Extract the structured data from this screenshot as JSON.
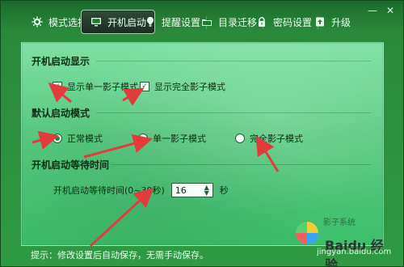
{
  "tabs": [
    {
      "label": "模式选择",
      "icon": "gear-icon",
      "active": false
    },
    {
      "label": "开机启动",
      "icon": "monitor-icon",
      "active": true
    },
    {
      "label": "提醒设置",
      "icon": "bulb-icon",
      "active": false
    },
    {
      "label": "目录迁移",
      "icon": "folder-icon",
      "active": false
    },
    {
      "label": "密码设置",
      "icon": "lock-icon",
      "active": false
    },
    {
      "label": "升级",
      "icon": "upgrade-icon",
      "active": false
    }
  ],
  "window_controls": {
    "minimize": "—",
    "close": "✕"
  },
  "sections": {
    "startup_display": {
      "title": "开机启动显示",
      "options": [
        {
          "label": "显示单一影子模式",
          "checked": true
        },
        {
          "label": "显示完全影子模式",
          "checked": true
        }
      ]
    },
    "default_mode": {
      "title": "默认启动模式",
      "options": [
        {
          "label": "正常模式",
          "selected": true
        },
        {
          "label": "单一影子模式",
          "selected": false
        },
        {
          "label": "完全影子模式",
          "selected": false
        }
      ]
    },
    "startup_wait": {
      "title": "开机启动等待时间",
      "label": "开机启动等待时间(0~30秒)",
      "value": "16",
      "unit": "秒"
    }
  },
  "status_text": "提示：修改设置后自动保存，无需手动保存。",
  "watermark": {
    "brand": "影子系统",
    "site": "jingyan.baidu.com"
  },
  "colors": {
    "accent": "#2a8a3a",
    "arrow": "#e23b3b"
  }
}
